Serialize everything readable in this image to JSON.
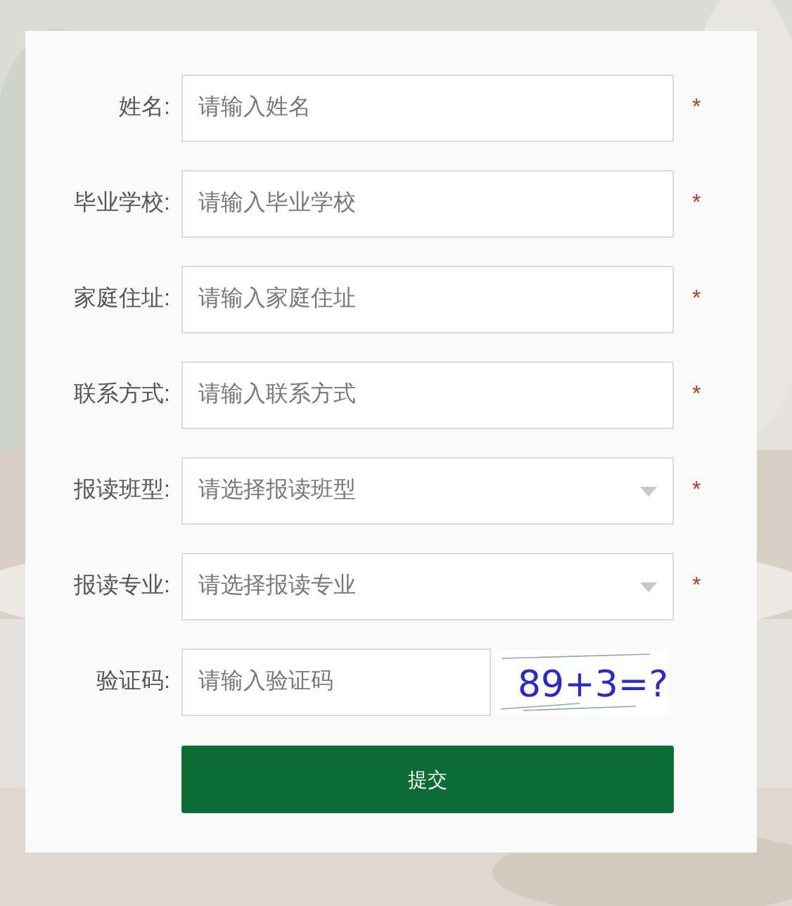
{
  "fields": [
    {
      "label": "姓名:",
      "kind": "text",
      "placeholder": "请输入姓名",
      "required_mark": "*"
    },
    {
      "label": "毕业学校:",
      "kind": "text",
      "placeholder": "请输入毕业学校",
      "required_mark": "*"
    },
    {
      "label": "家庭住址:",
      "kind": "text",
      "placeholder": "请输入家庭住址",
      "required_mark": "*"
    },
    {
      "label": "联系方式:",
      "kind": "text",
      "placeholder": "请输入联系方式",
      "required_mark": "*"
    },
    {
      "label": "报读班型:",
      "kind": "select",
      "placeholder": "请选择报读班型",
      "required_mark": "*"
    },
    {
      "label": "报读专业:",
      "kind": "select",
      "placeholder": "请选择报读专业",
      "required_mark": "*"
    }
  ],
  "captcha": {
    "label": "验证码:",
    "placeholder": "请输入验证码",
    "code": "89+3=?"
  },
  "submit": "提交"
}
